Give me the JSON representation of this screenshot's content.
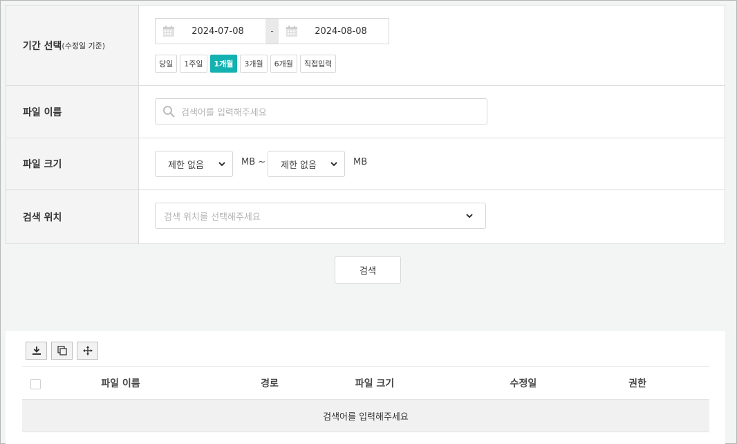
{
  "filters": {
    "period": {
      "label": "기간 선택",
      "label_note": "(수정일 기준)",
      "start_date": "2024-07-08",
      "separator": "-",
      "end_date": "2024-08-08",
      "presets": [
        "당일",
        "1주일",
        "1개월",
        "3개월",
        "6개월",
        "직접입력"
      ],
      "active_preset": "1개월"
    },
    "file_name": {
      "label": "파일 이름",
      "placeholder": "검색어를 입력해주세요"
    },
    "file_size": {
      "label": "파일 크기",
      "min_value": "제한 없음",
      "min_unit": "MB ~",
      "max_value": "제한 없음",
      "max_unit": "MB"
    },
    "location": {
      "label": "검색 위치",
      "placeholder": "검색 위치를 선택해주세요"
    },
    "search_button": "검색"
  },
  "results": {
    "toolbar_icons": [
      "download-icon",
      "copy-icon",
      "move-icon"
    ],
    "columns": [
      "파일 이름",
      "경로",
      "파일 크기",
      "수정일",
      "권한"
    ],
    "empty_message": "검색어를 입력해주세요"
  },
  "colors": {
    "accent": "#14b1b1",
    "background": "#f3f5f5",
    "label_bg": "#f4f4f4"
  }
}
